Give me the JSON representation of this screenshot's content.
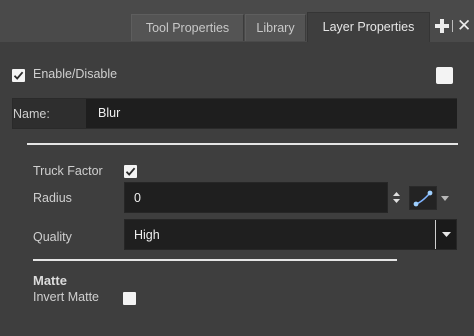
{
  "tabs": {
    "tool_properties": "Tool Properties",
    "library": "Library",
    "layer_properties": "Layer Properties"
  },
  "enable": {
    "label": "Enable/Disable",
    "checked": true
  },
  "name": {
    "label": "Name:",
    "value": "Blur"
  },
  "truck_factor": {
    "label": "Truck Factor",
    "checked": true
  },
  "radius": {
    "label": "Radius",
    "value": "0"
  },
  "quality": {
    "label": "Quality",
    "value": "High"
  },
  "matte": {
    "title": "Matte",
    "invert_label": "Invert Matte",
    "invert_checked": false
  },
  "icons": [
    "plus-icon",
    "close-icon",
    "spin-arrows-icon",
    "function-curve-icon",
    "dropdown-arrow-icon",
    "checkmark-icon"
  ]
}
